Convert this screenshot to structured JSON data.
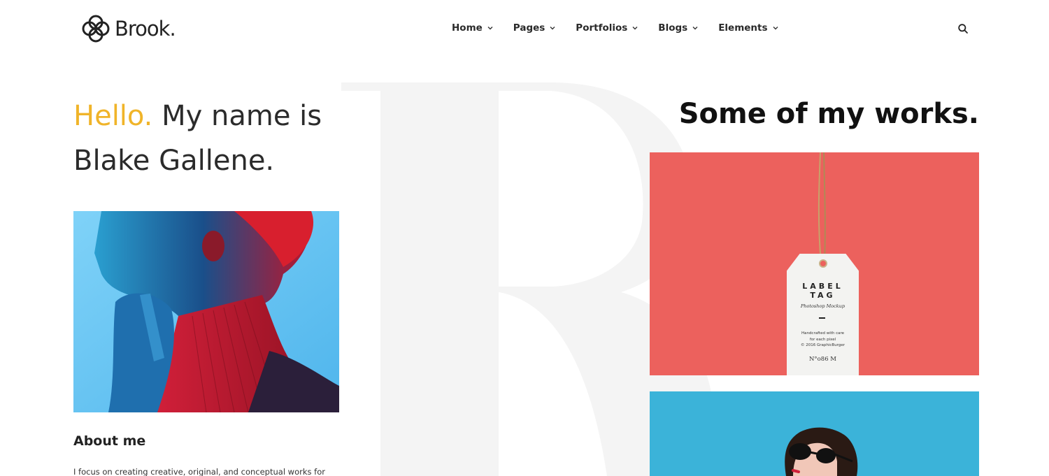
{
  "brand": {
    "name": "Brook."
  },
  "nav": {
    "items": [
      {
        "label": "Home"
      },
      {
        "label": "Pages"
      },
      {
        "label": "Portfolios"
      },
      {
        "label": "Blogs"
      },
      {
        "label": "Elements"
      }
    ]
  },
  "hero": {
    "greeting": "Hello.",
    "line1_rest": " My name is",
    "line2": "Blake Gallene."
  },
  "works": {
    "title": "Some of my works."
  },
  "about": {
    "heading": "About me",
    "text": "I focus on creating creative, original, and conceptual works for"
  },
  "tag_mockup": {
    "title_line1": "LABEL",
    "title_line2": "TAG",
    "subtitle": "Photoshop Mockup",
    "info_line1": "Handcrafted with care",
    "info_line2": "for each pixel",
    "info_line3": "© 2016 GraphicBurger",
    "meta": "N°o86   M"
  },
  "colors": {
    "accent": "#f0b429",
    "work1_bg": "#ec615d",
    "work2_bg": "#3bb3d9",
    "bg_letter": "#f4f4f4"
  },
  "icons": {
    "logo": "quatrefoil-logo-icon",
    "search": "search-icon",
    "chevron": "chevron-down-icon"
  }
}
